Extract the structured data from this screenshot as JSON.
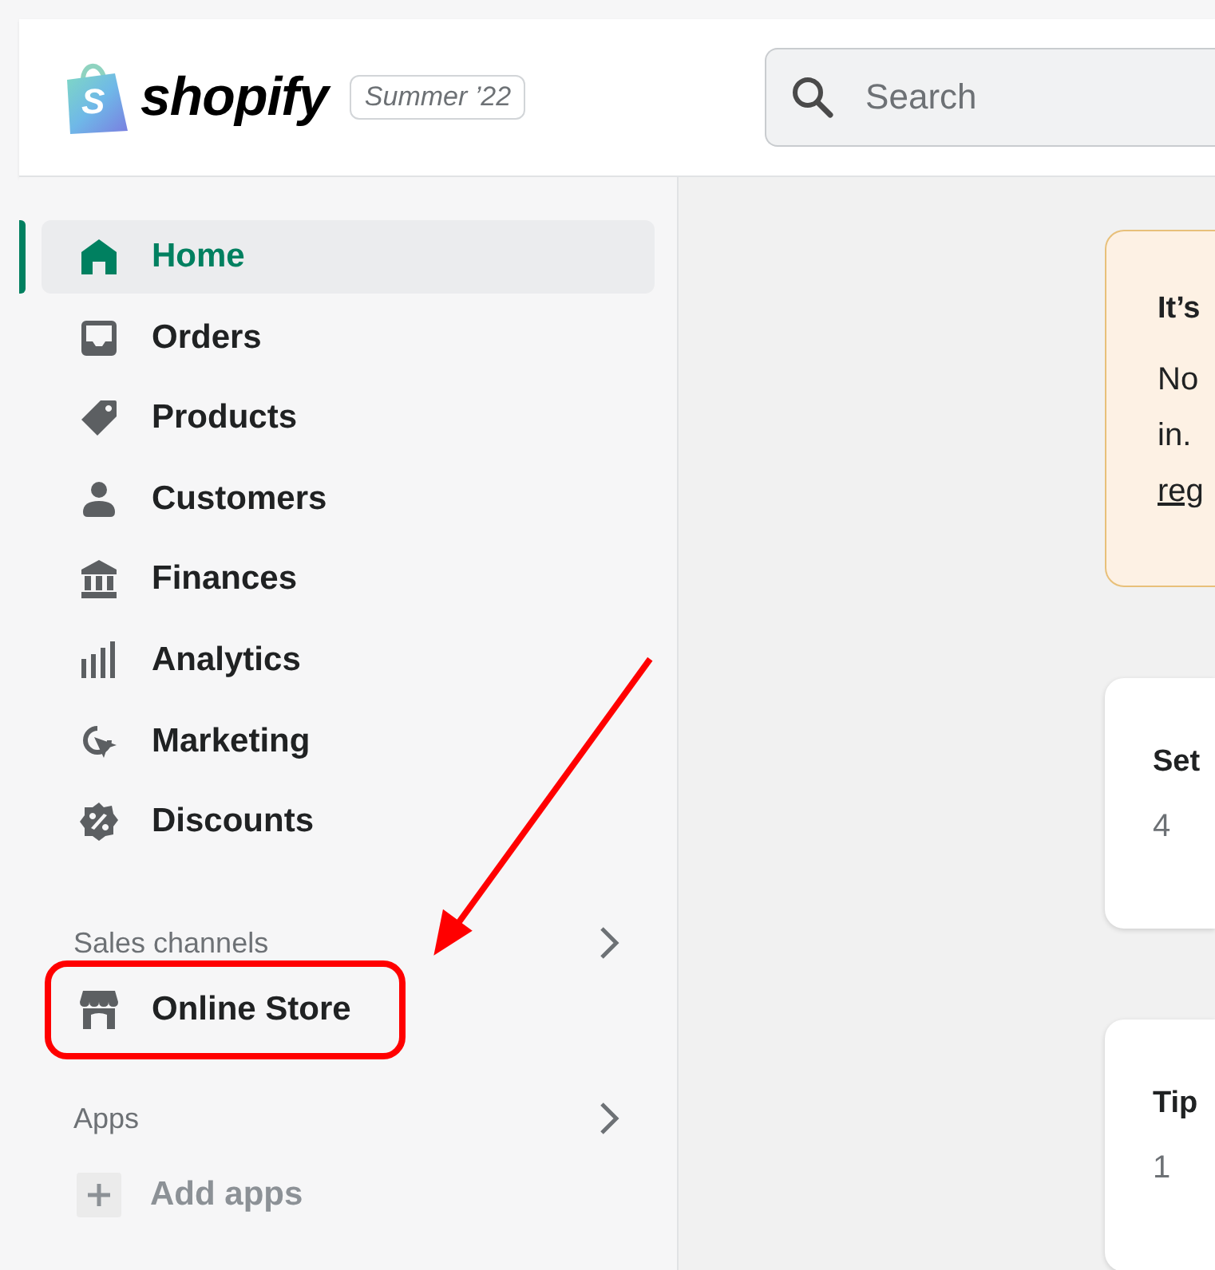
{
  "header": {
    "logo": {
      "mark": "S",
      "wordmark": "shopify"
    },
    "edition_badge": "Summer ’22",
    "search": {
      "placeholder": "Search"
    }
  },
  "sidebar": {
    "items": [
      {
        "label": "Home",
        "selected": true
      },
      {
        "label": "Orders",
        "selected": false
      },
      {
        "label": "Products",
        "selected": false
      },
      {
        "label": "Customers",
        "selected": false
      },
      {
        "label": "Finances",
        "selected": false
      },
      {
        "label": "Analytics",
        "selected": false
      },
      {
        "label": "Marketing",
        "selected": false
      },
      {
        "label": "Discounts",
        "selected": false
      }
    ],
    "sales_channels": {
      "title": "Sales channels",
      "items": [
        {
          "label": "Online Store",
          "highlighted": true
        }
      ]
    },
    "apps": {
      "title": "Apps",
      "add_label": "Add apps"
    }
  },
  "main": {
    "banner": {
      "title": "It’s",
      "lines": [
        "No",
        "in."
      ],
      "link": "reg"
    },
    "cards": [
      {
        "title": "Set",
        "subtitle": "4"
      },
      {
        "title": "Tip",
        "subtitle": "1"
      }
    ]
  }
}
